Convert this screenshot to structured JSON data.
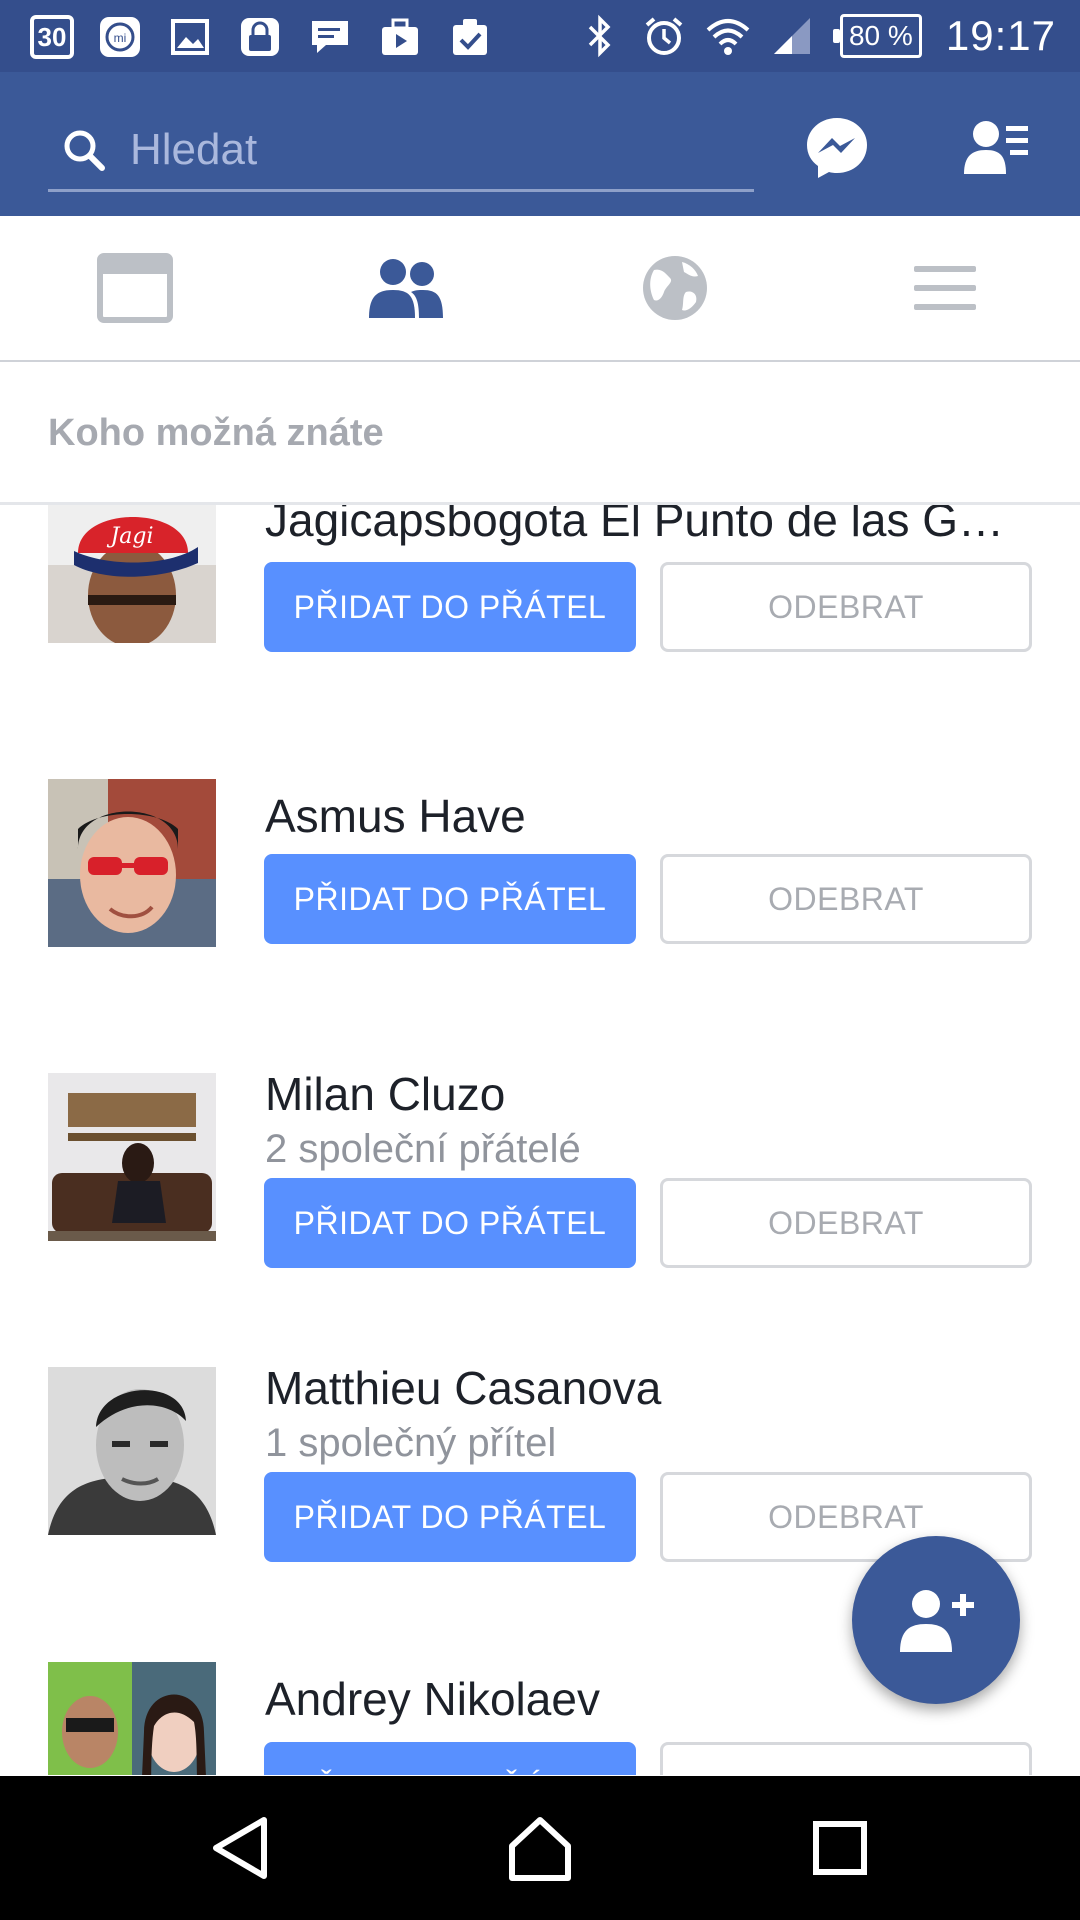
{
  "status_bar": {
    "calendar_day": "30",
    "battery": "80 %",
    "time": "19:17",
    "left_icons": [
      "calendar-icon",
      "mi-icon",
      "gallery-icon",
      "lock-icon",
      "message-icon",
      "video-icon",
      "clipboard-check-icon"
    ],
    "right_icons": [
      "bluetooth-icon",
      "alarm-icon",
      "wifi-icon",
      "signal-icon"
    ]
  },
  "header": {
    "search_placeholder": "Hledat",
    "messenger_icon": "messenger-icon",
    "friend_requests_icon": "friend-requests-icon",
    "bg_color": "#3b5998"
  },
  "tabs": [
    {
      "name": "news-feed",
      "icon": "news-feed-icon",
      "active": false
    },
    {
      "name": "friends",
      "icon": "friends-icon",
      "active": true
    },
    {
      "name": "notifications",
      "icon": "globe-icon",
      "active": false
    },
    {
      "name": "menu",
      "icon": "menu-icon",
      "active": false
    }
  ],
  "section": {
    "title": "Koho možná znáte"
  },
  "people": [
    {
      "name": "Jagicapsbogota El Punto de las G…",
      "mutual": "",
      "add_label": "PŘIDAT DO PŘÁTEL",
      "remove_label": "ODEBRAT"
    },
    {
      "name": "Asmus Have",
      "mutual": "",
      "add_label": "PŘIDAT DO PŘÁTEL",
      "remove_label": "ODEBRAT"
    },
    {
      "name": "Milan Cluzo",
      "mutual": "2 společní přátelé",
      "add_label": "PŘIDAT DO PŘÁTEL",
      "remove_label": "ODEBRAT"
    },
    {
      "name": "Matthieu Casanova",
      "mutual": "1 společný přítel",
      "add_label": "PŘIDAT DO PŘÁTEL",
      "remove_label": "ODEBRAT"
    },
    {
      "name": "Andrey Nikolaev",
      "mutual": "",
      "add_label": "PŘIDAT DO PŘÁTEL",
      "remove_label": "ODEBRAT"
    }
  ],
  "fab": {
    "icon": "add-friend-icon"
  },
  "nav": {
    "icons": [
      "back-icon",
      "home-icon",
      "recents-icon"
    ]
  },
  "colors": {
    "accent": "#5890ff",
    "brand": "#3b5998",
    "muted_text": "#90949c"
  }
}
